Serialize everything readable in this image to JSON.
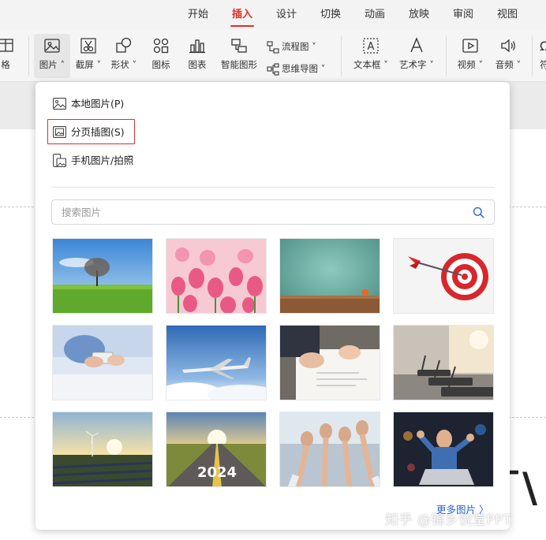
{
  "tabs": [
    {
      "label": "开始",
      "active": false
    },
    {
      "label": "插入",
      "active": true
    },
    {
      "label": "设计",
      "active": false
    },
    {
      "label": "切换",
      "active": false
    },
    {
      "label": "动画",
      "active": false
    },
    {
      "label": "放映",
      "active": false
    },
    {
      "label": "审阅",
      "active": false
    },
    {
      "label": "视图",
      "active": false
    }
  ],
  "ribbon": {
    "table_label": "格",
    "picture_label": "图片",
    "screenshot_label": "截屏",
    "shape_label": "形状",
    "icon_label": "图标",
    "chart_label": "图表",
    "smartart_label": "智能图形",
    "flowchart_label": "流程图",
    "mindmap_label": "思维导图",
    "textbox_label": "文本框",
    "wordart_label": "艺术字",
    "video_label": "视频",
    "audio_label": "音频",
    "overflow_label": "符"
  },
  "picture_menu": {
    "local_picture": "本地图片(P)",
    "paginated_insert": "分页插图(S)",
    "phone_picture": "手机图片/拍照",
    "search_placeholder": "搜索图片",
    "more_pictures": "更多图片",
    "thumbnails": [
      {
        "name": "tree-on-meadow"
      },
      {
        "name": "pink-tulips"
      },
      {
        "name": "teal-wall-with-orange"
      },
      {
        "name": "dart-target"
      },
      {
        "name": "hands-with-phone"
      },
      {
        "name": "airplane-above-clouds"
      },
      {
        "name": "signing-documents"
      },
      {
        "name": "gym-treadmills"
      },
      {
        "name": "wind-turbines-solar-field"
      },
      {
        "name": "road-2024-sunset"
      },
      {
        "name": "team-raised-fists"
      },
      {
        "name": "cheering-man-laptop"
      }
    ],
    "road_text": "2024"
  },
  "watermark": "知乎 @锦乡悦堂PPT",
  "colors": {
    "accent_red": "#d9302c",
    "link_blue": "#2b64c5"
  }
}
